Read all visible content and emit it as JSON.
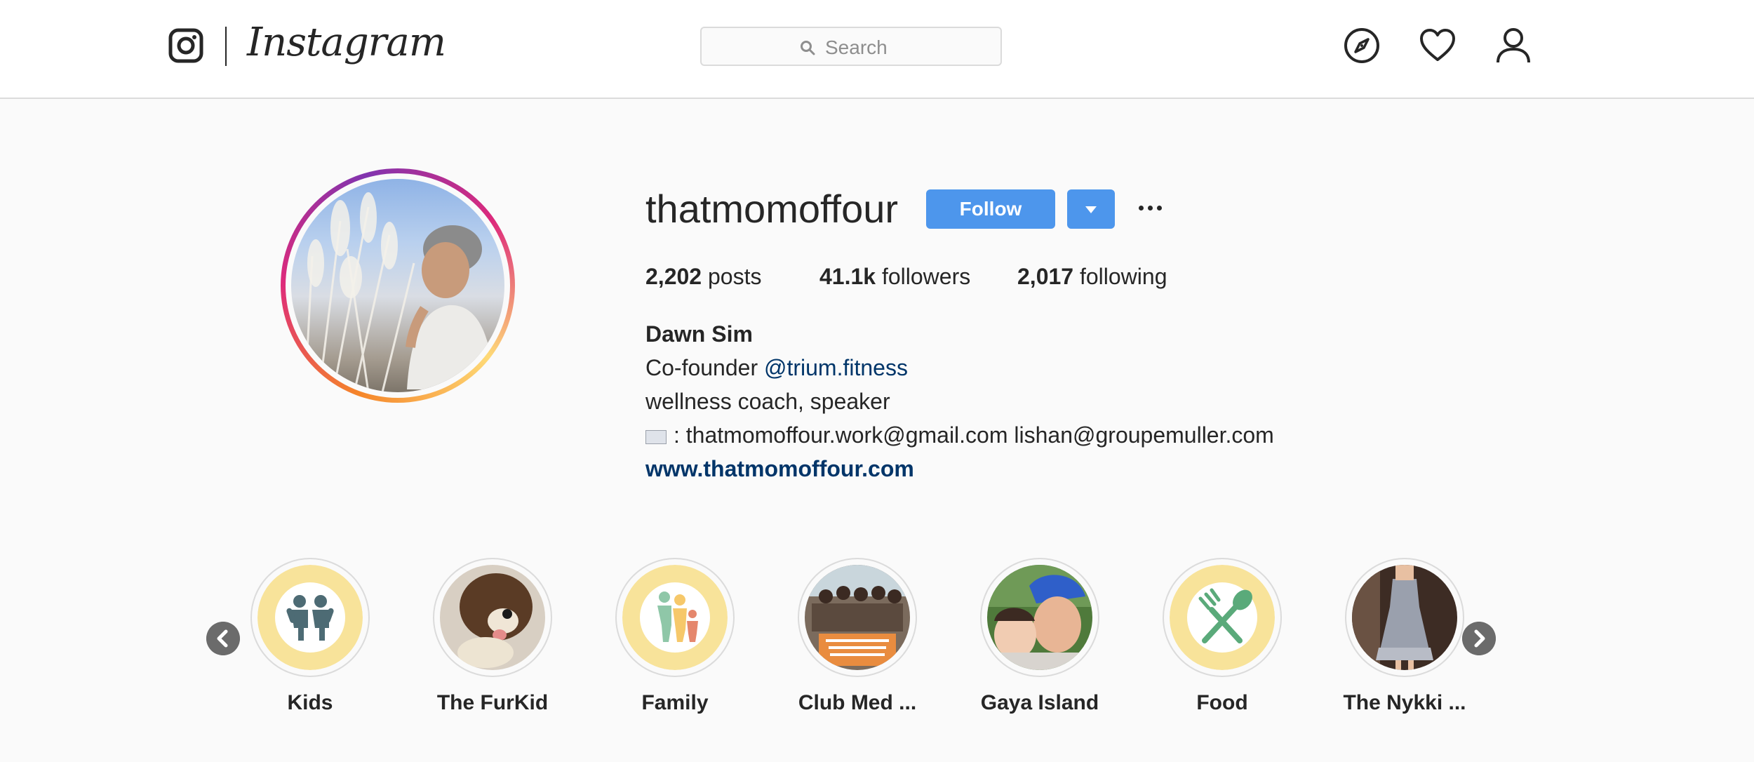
{
  "nav": {
    "brand": "Instagram",
    "search_placeholder": "Search"
  },
  "profile": {
    "username": "thatmomoffour",
    "follow_label": "Follow",
    "stats": {
      "posts_count": "2,202",
      "posts_label": "posts",
      "followers_count": "41.1k",
      "followers_label": "followers",
      "following_count": "2,017",
      "following_label": "following"
    },
    "bio": {
      "name": "Dawn Sim",
      "line1_prefix": "Co-founder",
      "line1_mention": "@trium.fitness",
      "line2": "wellness coach, speaker",
      "line3": ": thatmomoffour.work@gmail.com lishan@groupemuller.com",
      "website": "www.thatmomoffour.com"
    }
  },
  "highlights": [
    {
      "label": "Kids",
      "icon": "kids-icon"
    },
    {
      "label": "The FurKid",
      "icon": "dog-photo"
    },
    {
      "label": "Family",
      "icon": "family-icon"
    },
    {
      "label": "Club Med ...",
      "icon": "club-med-photo"
    },
    {
      "label": "Gaya Island",
      "icon": "selfie-photo"
    },
    {
      "label": "Food",
      "icon": "utensils-icon"
    },
    {
      "label": "The Nykki ...",
      "icon": "dress-photo"
    }
  ],
  "colors": {
    "accent": "#4d96ec",
    "link": "#003569",
    "highlight_fill": "#f8e39a"
  }
}
